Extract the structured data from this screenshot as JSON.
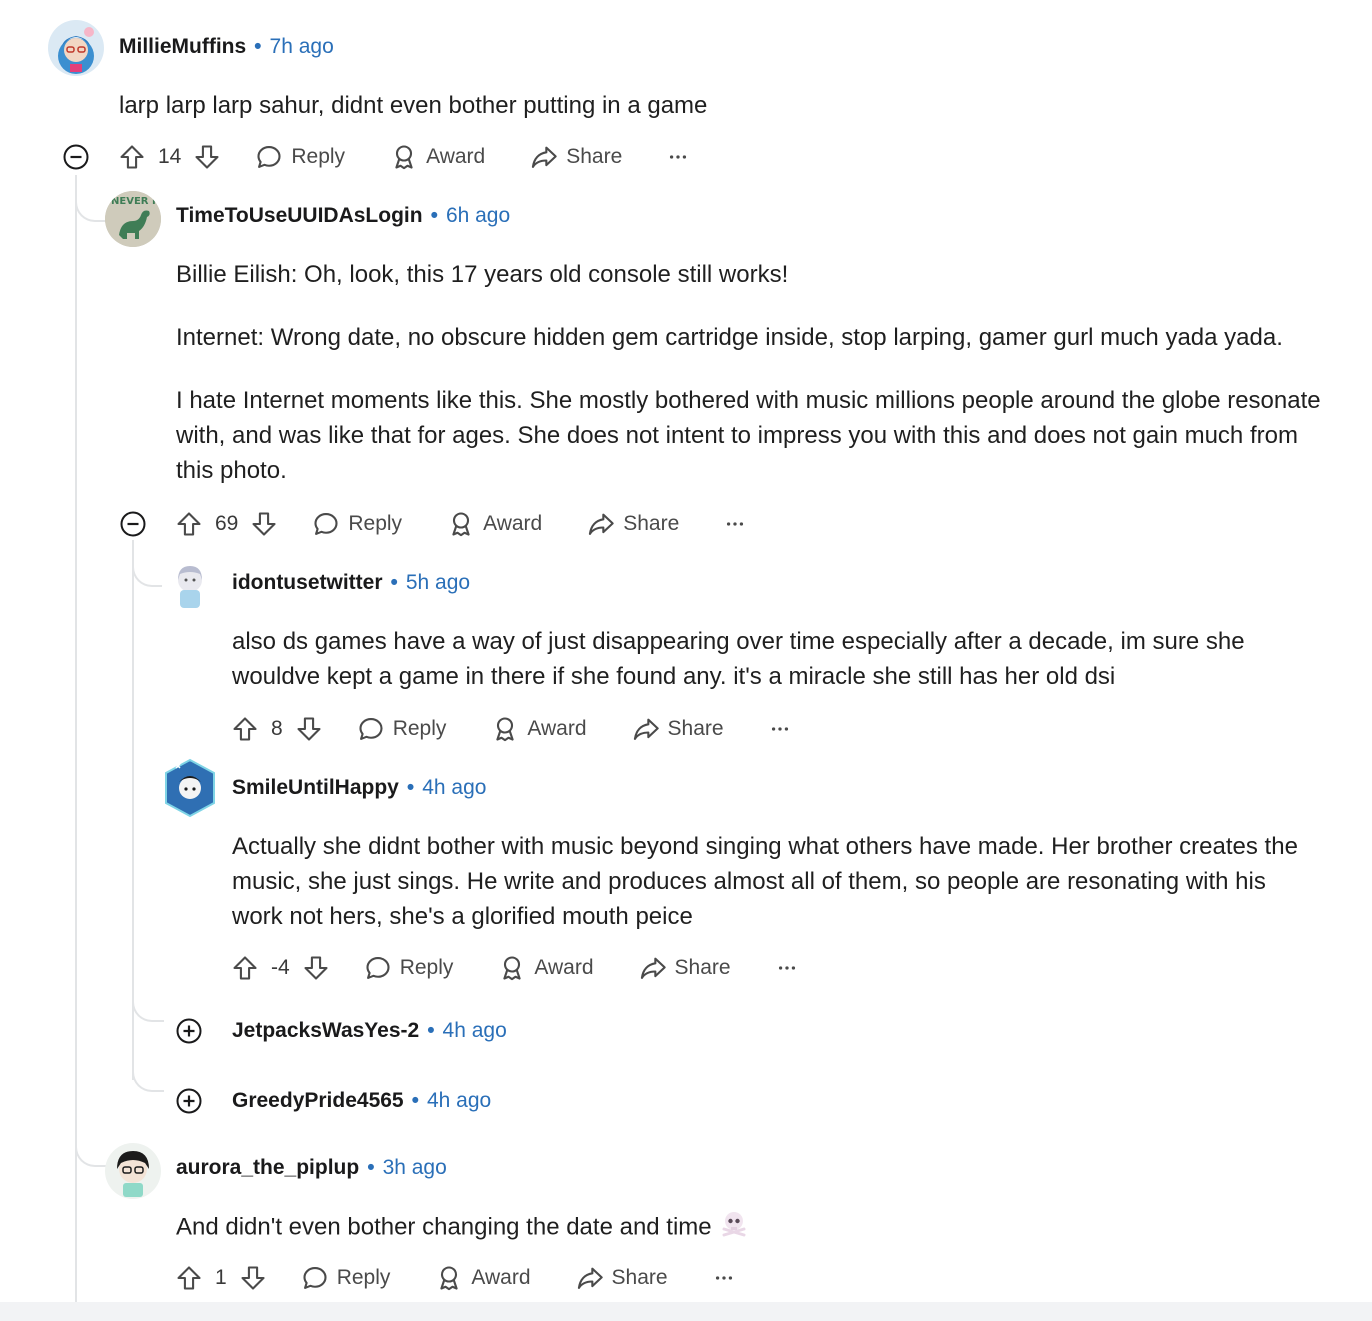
{
  "colors": {
    "link_blue": "#2a6fb8",
    "thread_line": "#e2e4e6",
    "action_gray": "#4a4a4a"
  },
  "actions": {
    "reply": "Reply",
    "award": "Award",
    "share": "Share",
    "more": "···"
  },
  "comments": {
    "c1": {
      "author": "MillieMuffins",
      "separator": "•",
      "time": "7h ago",
      "body": "larp larp larp sahur, didnt even bother putting in a game",
      "score": "14"
    },
    "c2": {
      "author": "TimeToUseUUIDAsLogin",
      "separator": "•",
      "time": "6h ago",
      "avatar_text": "NEVER FORGET",
      "body": [
        "Billie Eilish: Oh, look, this 17 years old console still works!",
        "Internet: Wrong date, no obscure hidden gem cartridge inside, stop larping, gamer gurl much yada yada.",
        "I hate Internet moments like this. She mostly bothered with music millions people around the globe resonate with, and was like that for ages. She does not intent to impress you with this and does not gain much from this photo."
      ],
      "score": "69"
    },
    "c3": {
      "author": "idontusetwitter",
      "separator": "•",
      "time": "5h ago",
      "body": "also ds games have a way of just disappearing over time especially after a decade, im sure she wouldve kept a game in there if she found any. it's a miracle she still has her old dsi",
      "score": "8"
    },
    "c4": {
      "author": "SmileUntilHappy",
      "separator": "•",
      "time": "4h ago",
      "body": "Actually she didnt bother with music beyond singing what others have made. Her brother creates the music, she just sings. He write and produces almost all of them, so people are resonating with his work not hers, she's a glorified mouth peice",
      "score": "-4"
    },
    "c5": {
      "author": "JetpacksWasYes-2",
      "separator": "•",
      "time": "4h ago"
    },
    "c6": {
      "author": "GreedyPride4565",
      "separator": "•",
      "time": "4h ago"
    },
    "c7": {
      "author": "aurora_the_piplup",
      "separator": "•",
      "time": "3h ago",
      "body": "And didn't even bother changing the date and time",
      "emoji": "skull-and-crossbones-emoji",
      "score": "1"
    }
  }
}
